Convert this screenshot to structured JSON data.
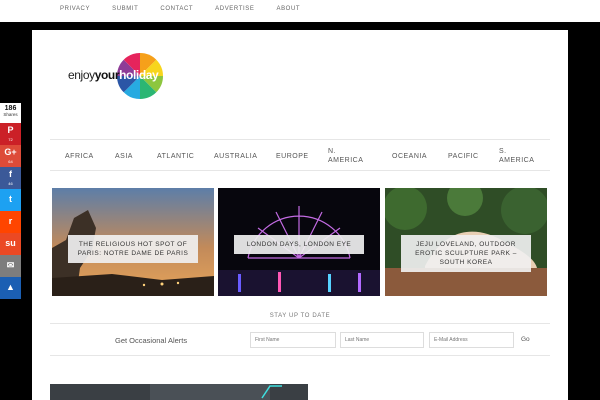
{
  "topnav": [
    "PRIVACY",
    "SUBMIT",
    "CONTACT",
    "ADVERTISE",
    "ABOUT"
  ],
  "logo": {
    "text_pre": "enjoy",
    "text_bold": "your",
    "text_holiday": "holiday"
  },
  "categories": [
    "AFRICA",
    "ASIA",
    "ATLANTIC",
    "AUSTRALIA",
    "EUROPE",
    "N.\nAMERICA",
    "OCEANIA",
    "PACIFIC",
    "S.\nAMERICA"
  ],
  "cards": [
    {
      "caption": "THE RELIGIOUS HOT SPOT OF PARIS: NOTRE DAME DE PARIS"
    },
    {
      "caption": "LONDON DAYS, LONDON EYE"
    },
    {
      "caption": "JEJU LOVELAND, OUTDOOR EROTIC SCULPTURE PARK – SOUTH KOREA"
    }
  ],
  "newsletter": {
    "heading": "STAY UP TO DATE",
    "label": "Get Occasional Alerts",
    "first_name_placeholder": "First Name",
    "last_name_placeholder": "Last Name",
    "email_placeholder": "E-Mail Address",
    "submit": "Go"
  },
  "share": {
    "total": "186",
    "total_label": "Shares",
    "buttons": [
      {
        "icon": "pinterest-icon",
        "glyph": "P",
        "count": "72",
        "color": "#cb2027"
      },
      {
        "icon": "googleplus-icon",
        "glyph": "G+",
        "count": "64",
        "color": "#dd4b39"
      },
      {
        "icon": "facebook-icon",
        "glyph": "f",
        "count": "46",
        "color": "#3b5998"
      },
      {
        "icon": "twitter-icon",
        "glyph": "t",
        "count": "",
        "color": "#1da1f2"
      },
      {
        "icon": "reddit-icon",
        "glyph": "r",
        "count": "",
        "color": "#ff4500"
      },
      {
        "icon": "stumbleupon-icon",
        "glyph": "su",
        "count": "",
        "color": "#eb4924"
      },
      {
        "icon": "email-icon",
        "glyph": "✉",
        "count": "",
        "color": "#7d7d7d"
      },
      {
        "icon": "sumome-icon",
        "glyph": "▲",
        "count": "",
        "color": "#1b5fb3"
      }
    ]
  }
}
